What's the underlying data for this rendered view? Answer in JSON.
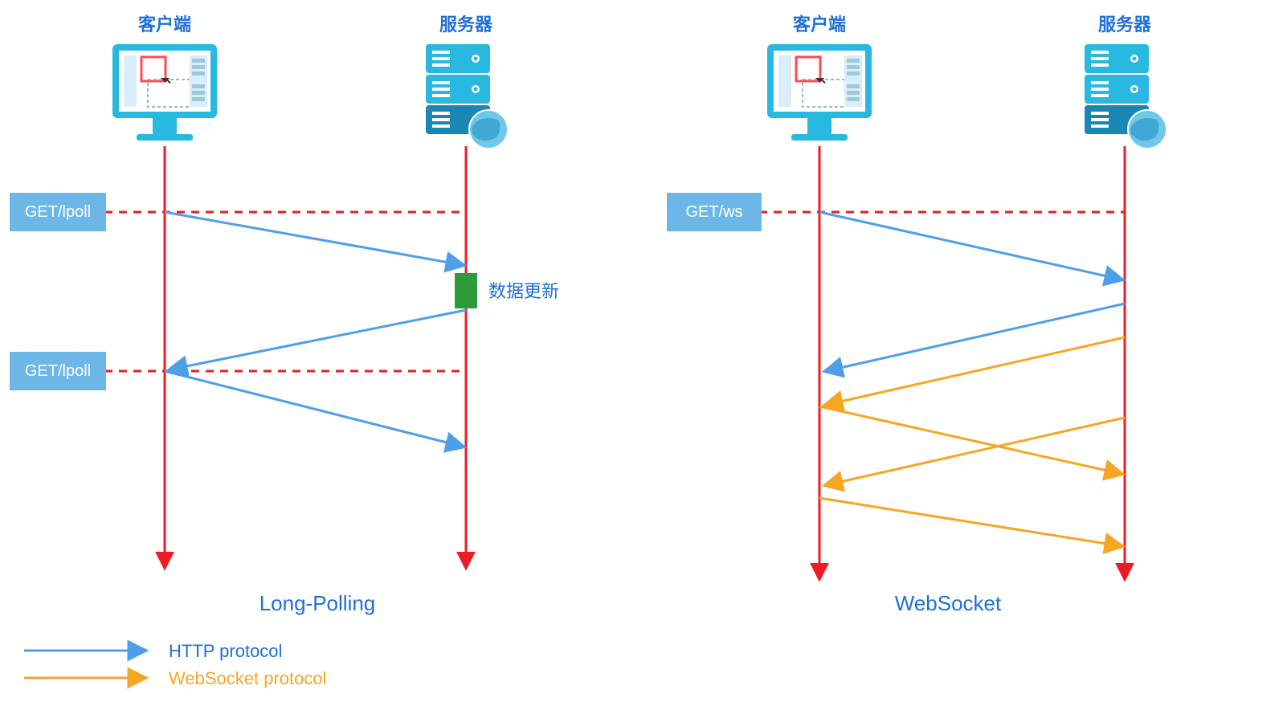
{
  "labels": {
    "client": "客户端",
    "server": "服务器",
    "data_update": "数据更新",
    "long_polling_title": "Long-Polling",
    "websocket_title": "WebSocket",
    "long_poll_req": "GET/lpoll",
    "ws_req": "GET/ws",
    "http_protocol": "HTTP protocol",
    "ws_protocol": "WebSocket protocol"
  },
  "colors": {
    "red": "#ed1c24",
    "blue_text": "#1f6fd8",
    "http_blue": "#4f9eea",
    "ws_orange": "#f5a623",
    "box_blue": "#6db7e8",
    "green": "#2e9b3a",
    "server_cyan": "#29b8e0",
    "server_dark": "#1986b3"
  }
}
